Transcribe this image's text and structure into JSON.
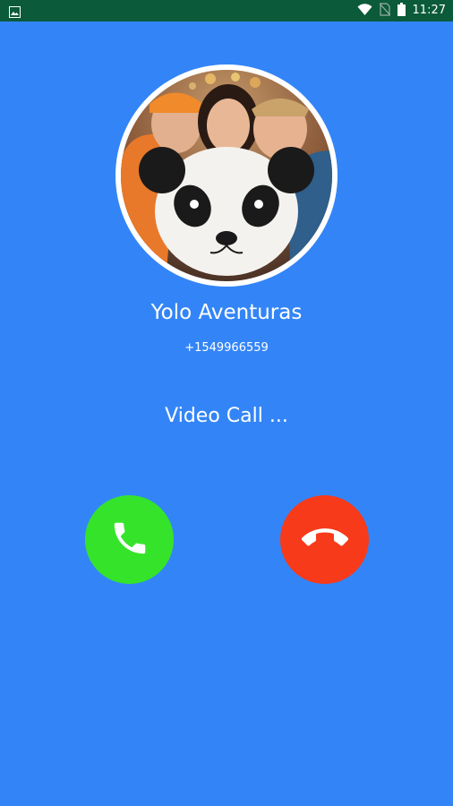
{
  "status_bar": {
    "time": "11:27",
    "left_icon": "image-notification-icon",
    "icons": [
      "wifi-icon",
      "no-sim-icon",
      "battery-icon"
    ]
  },
  "caller": {
    "name": "Yolo Aventuras",
    "number": "+1549966559"
  },
  "call": {
    "status_text": "Video Call ..."
  },
  "buttons": {
    "accept_icon": "phone-icon",
    "decline_icon": "hang-up-icon"
  },
  "colors": {
    "background": "#3385f7",
    "status_bar": "#0b5a3a",
    "accept": "#35e42a",
    "decline": "#f73a1a"
  }
}
